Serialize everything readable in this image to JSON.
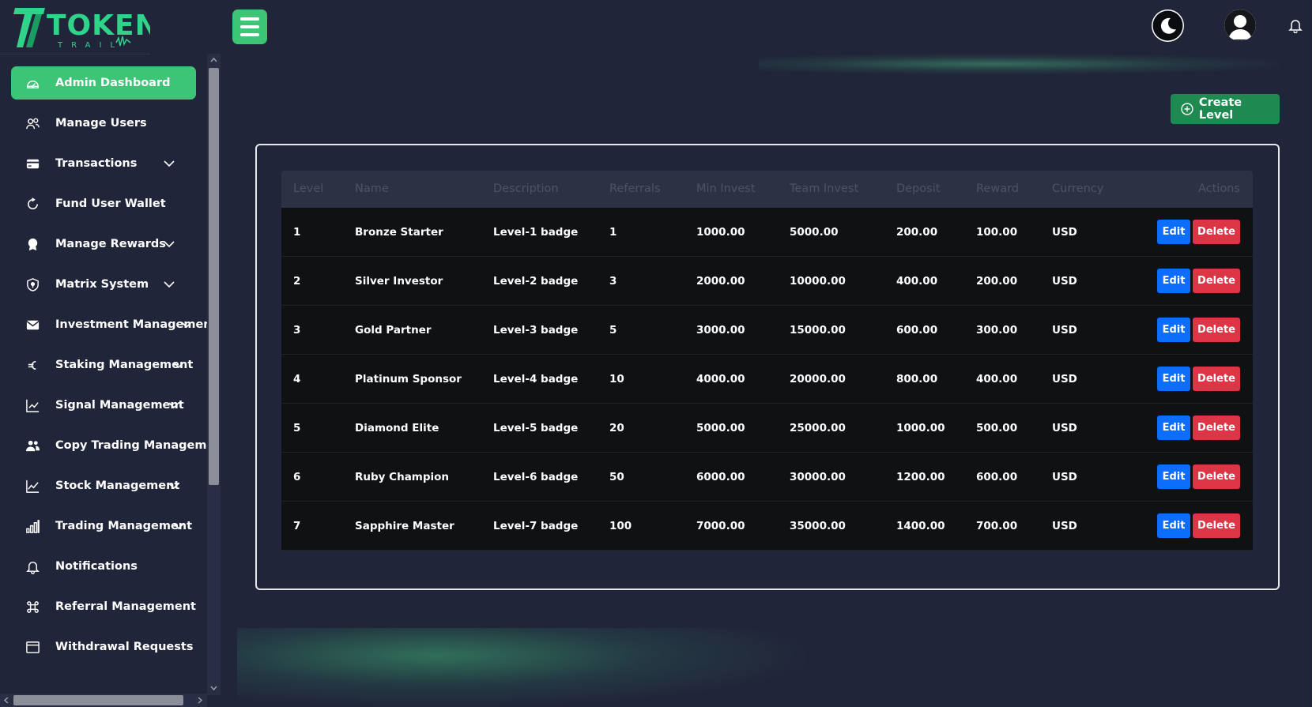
{
  "brand": {
    "logo_main": "TOKEN",
    "logo_sub": "TRAIL"
  },
  "sidebar": {
    "items": [
      {
        "label": "Admin Dashboard",
        "icon": "gauge-icon",
        "active": true,
        "has_submenu": false
      },
      {
        "label": "Manage Users",
        "icon": "users-icon",
        "active": false,
        "has_submenu": false
      },
      {
        "label": "Transactions",
        "icon": "credit-card-icon",
        "active": false,
        "has_submenu": true
      },
      {
        "label": "Fund User Wallet",
        "icon": "refresh-icon",
        "active": false,
        "has_submenu": false
      },
      {
        "label": "Manage Rewards",
        "icon": "award-icon",
        "active": false,
        "has_submenu": true
      },
      {
        "label": "Matrix System",
        "icon": "shield-icon",
        "active": false,
        "has_submenu": true
      },
      {
        "label": "Investment Management",
        "icon": "envelope-icon",
        "active": false,
        "has_submenu": true
      },
      {
        "label": "Staking Management",
        "icon": "euro-icon",
        "active": false,
        "has_submenu": true
      },
      {
        "label": "Signal Management",
        "icon": "chart-line-icon",
        "active": false,
        "has_submenu": true
      },
      {
        "label": "Copy Trading Management",
        "icon": "people-icon",
        "active": false,
        "has_submenu": true
      },
      {
        "label": "Stock Management",
        "icon": "graph-up-icon",
        "active": false,
        "has_submenu": true
      },
      {
        "label": "Trading Management",
        "icon": "bar-chart-icon",
        "active": false,
        "has_submenu": true
      },
      {
        "label": "Notifications",
        "icon": "bell-icon",
        "active": false,
        "has_submenu": false
      },
      {
        "label": "Referral Management",
        "icon": "command-icon",
        "active": false,
        "has_submenu": false
      },
      {
        "label": "Withdrawal Requests",
        "icon": "window-icon",
        "active": false,
        "has_submenu": false
      }
    ]
  },
  "header": {
    "menu_icon": "hamburger-icon",
    "theme_icon": "moon-icon",
    "avatar_icon": "user-avatar-icon",
    "bell_icon": "bell-icon"
  },
  "actions": {
    "create_label": "Create Level",
    "create_icon": "plus-circle-icon"
  },
  "table": {
    "columns": [
      "Level",
      "Name",
      "Description",
      "Referrals",
      "Min Invest",
      "Team Invest",
      "Deposit",
      "Reward",
      "Currency",
      "Actions"
    ],
    "rows": [
      {
        "level": "1",
        "name": "Bronze Starter",
        "description": "Level-1 badge",
        "referrals": "1",
        "min_invest": "1000.00",
        "team_invest": "5000.00",
        "deposit": "200.00",
        "reward": "100.00",
        "currency": "USD"
      },
      {
        "level": "2",
        "name": "Silver Investor",
        "description": "Level-2 badge",
        "referrals": "3",
        "min_invest": "2000.00",
        "team_invest": "10000.00",
        "deposit": "400.00",
        "reward": "200.00",
        "currency": "USD"
      },
      {
        "level": "3",
        "name": "Gold Partner",
        "description": "Level-3 badge",
        "referrals": "5",
        "min_invest": "3000.00",
        "team_invest": "15000.00",
        "deposit": "600.00",
        "reward": "300.00",
        "currency": "USD"
      },
      {
        "level": "4",
        "name": "Platinum Sponsor",
        "description": "Level-4 badge",
        "referrals": "10",
        "min_invest": "4000.00",
        "team_invest": "20000.00",
        "deposit": "800.00",
        "reward": "400.00",
        "currency": "USD"
      },
      {
        "level": "5",
        "name": "Diamond Elite",
        "description": "Level-5 badge",
        "referrals": "20",
        "min_invest": "5000.00",
        "team_invest": "25000.00",
        "deposit": "1000.00",
        "reward": "500.00",
        "currency": "USD"
      },
      {
        "level": "6",
        "name": "Ruby Champion",
        "description": "Level-6 badge",
        "referrals": "50",
        "min_invest": "6000.00",
        "team_invest": "30000.00",
        "deposit": "1200.00",
        "reward": "600.00",
        "currency": "USD"
      },
      {
        "level": "7",
        "name": "Sapphire Master",
        "description": "Level-7 badge",
        "referrals": "100",
        "min_invest": "7000.00",
        "team_invest": "35000.00",
        "deposit": "1400.00",
        "reward": "700.00",
        "currency": "USD"
      }
    ],
    "edit_label": "Edit",
    "delete_label": "Delete"
  },
  "colors": {
    "background": "#212539",
    "accent": "#3cc477",
    "create": "#1e8a52",
    "edit": "#0d6efd",
    "delete": "#dc3545",
    "row": "#101113",
    "header_row": "#2d3144"
  }
}
